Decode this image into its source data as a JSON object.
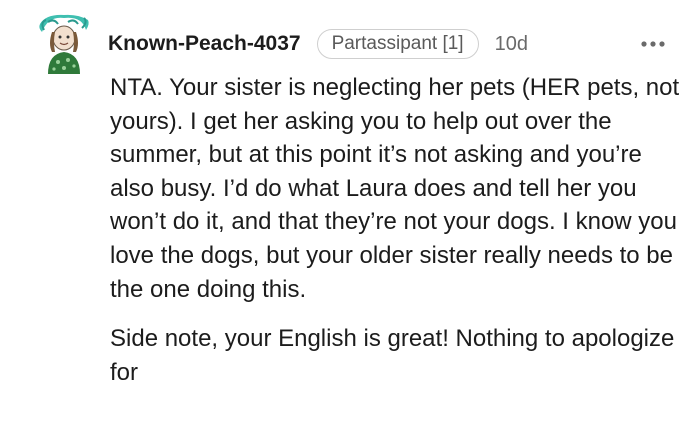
{
  "comment": {
    "username": "Known-Peach-4037",
    "flair": "Partassipant [1]",
    "age": "10d",
    "paragraphs": [
      "NTA. Your sister is neglecting her pets (HER pets, not yours). I get her asking you to help out over the summer, but at this point it’s not asking and you’re also busy. I’d do what Laura does and tell her you won’t do it, and that they’re not your dogs. I know you love the dogs, but your older sister really needs to be the one doing this.",
      "Side note, your English is great! Nothing to apologize for"
    ]
  },
  "icons": {
    "avatar": "user-avatar",
    "more": "more-options-icon"
  },
  "colors": {
    "text": "#1c1c1c",
    "meta": "#6a6a6a",
    "flair_border": "#cfcfcf",
    "avatar_hair": "#3fbfb0",
    "avatar_body": "#2f7a3a"
  }
}
